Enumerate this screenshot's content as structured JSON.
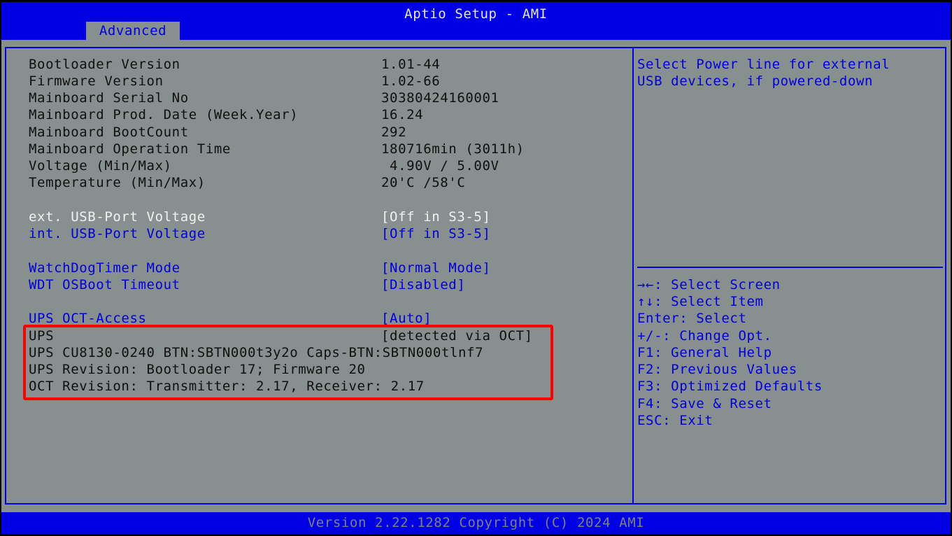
{
  "header": {
    "title": "Aptio Setup - AMI",
    "tab": "Advanced"
  },
  "info_rows": [
    {
      "label": "Bootloader Version",
      "value": "1.01-44"
    },
    {
      "label": "Firmware Version",
      "value": "1.02-66"
    },
    {
      "label": "Mainboard Serial No",
      "value": "30380424160001"
    },
    {
      "label": "Mainboard Prod. Date (Week.Year)",
      "value": "16.24"
    },
    {
      "label": "Mainboard BootCount",
      "value": "292"
    },
    {
      "label": "Mainboard Operation Time",
      "value": "180716min (3011h)"
    },
    {
      "label": "Voltage (Min/Max)",
      "value": " 4.90V / 5.00V"
    },
    {
      "label": "Temperature (Min/Max)",
      "value": "20'C /58'C"
    }
  ],
  "settings": {
    "ext_usb_voltage": {
      "label": "ext. USB-Port Voltage",
      "value": "[Off in S3-5]"
    },
    "int_usb_voltage": {
      "label": "int. USB-Port Voltage",
      "value": "[Off in S3-5]"
    },
    "watchdog_mode": {
      "label": "WatchDogTimer Mode",
      "value": "[Normal Mode]"
    },
    "wdt_osboot_timeout": {
      "label": "WDT OSBoot Timeout",
      "value": "[Disabled]"
    },
    "ups_oct_access": {
      "label": "UPS OCT-Access",
      "value": "[Auto]"
    }
  },
  "ups_info": {
    "ups_label": "UPS",
    "ups_value": "[detected via OCT]",
    "ups_model": "UPS CU8130-0240 BTN:SBTN000t3y2o Caps-BTN:SBTN000tlnf7",
    "ups_revision": "UPS Revision: Bootloader 17; Firmware 20",
    "oct_revision": "OCT Revision: Transmitter: 2.17, Receiver: 2.17"
  },
  "help": {
    "line1": "Select Power line for external",
    "line2": "USB devices, if powered-down"
  },
  "nav_keys": [
    "→←: Select Screen",
    "↑↓: Select Item",
    "Enter: Select",
    "+/-: Change Opt.",
    "F1: General Help",
    "F2: Previous Values",
    "F3: Optimized Defaults",
    "F4: Save & Reset",
    "ESC: Exit"
  ],
  "footer": {
    "text": "Version 2.22.1282 Copyright (C) 2024 AMI"
  },
  "colors": {
    "header_blue": "#0000e2",
    "panel_grey": "#878f8f",
    "highlight_red": "#ff0000"
  }
}
